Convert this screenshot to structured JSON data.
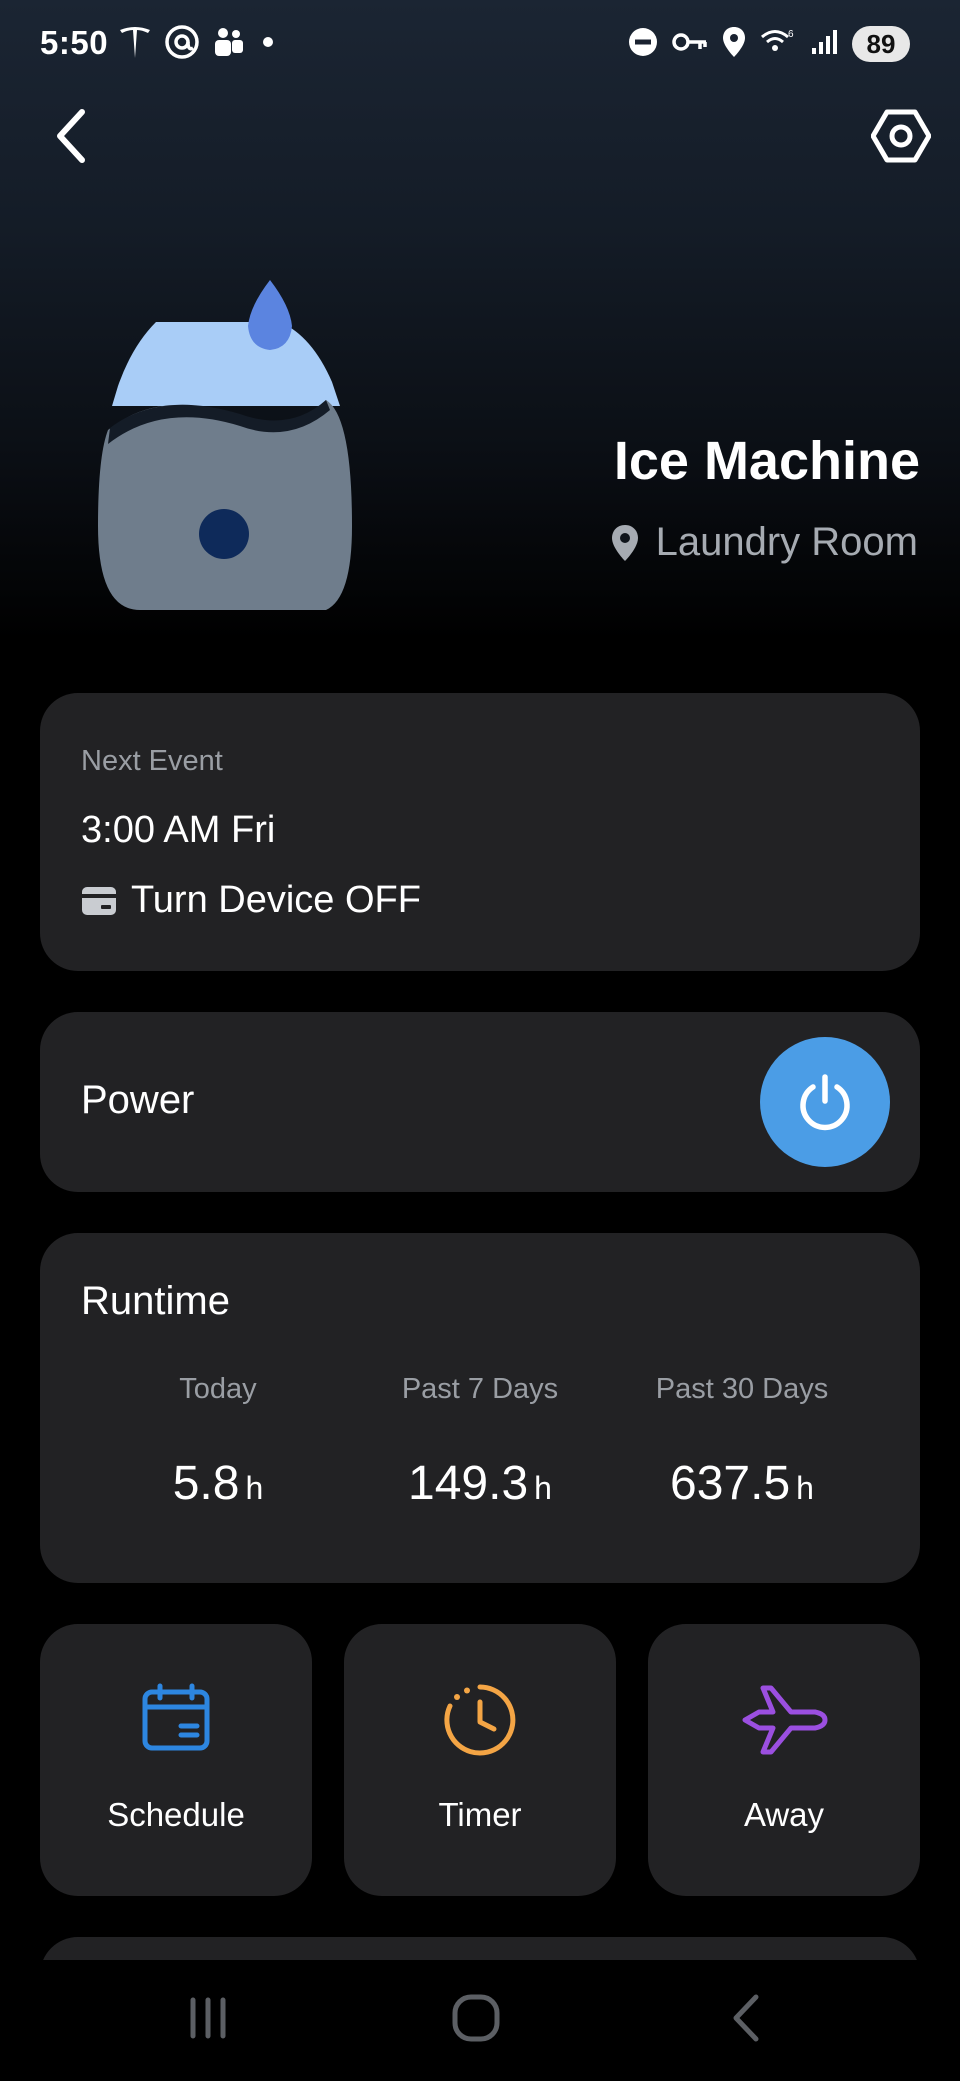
{
  "status_bar": {
    "time": "5:50",
    "left_icons": [
      "tesla-icon",
      "threads-icon",
      "teams-icon",
      "notification-dot-icon"
    ],
    "right_icons": [
      "do-not-disturb-icon",
      "vpn-key-icon",
      "location-icon",
      "wifi-6-icon",
      "cell-signal-icon"
    ],
    "battery": "89"
  },
  "nav": {
    "back_icon": "chevron-left-icon",
    "settings_icon": "hex-settings-icon"
  },
  "device": {
    "name": "Ice Machine",
    "location": "Laundry Room",
    "colors": {
      "top": "#a9cdf7",
      "body": "#6f7d8c",
      "drop": "#5b84e0",
      "dot": "#0e2a5a"
    }
  },
  "next_event": {
    "label": "Next Event",
    "time": "3:00 AM Fri",
    "action": "Turn Device OFF"
  },
  "power": {
    "label": "Power",
    "state": "on",
    "accent": "#4b9de6"
  },
  "runtime": {
    "title": "Runtime",
    "stats": [
      {
        "label": "Today",
        "value": "5.8",
        "unit": "h"
      },
      {
        "label": "Past 7 Days",
        "value": "149.3",
        "unit": "h"
      },
      {
        "label": "Past 30 Days",
        "value": "637.5",
        "unit": "h"
      }
    ]
  },
  "actions": [
    {
      "label": "Schedule",
      "icon": "calendar-icon",
      "color": "#2d86e0"
    },
    {
      "label": "Timer",
      "icon": "clock-icon",
      "color": "#f4a545"
    },
    {
      "label": "Away",
      "icon": "airplane-icon",
      "color": "#9b4fe0"
    }
  ],
  "system_nav": {
    "recents_icon": "recents-icon",
    "home_icon": "home-icon",
    "back_icon": "back-icon"
  }
}
